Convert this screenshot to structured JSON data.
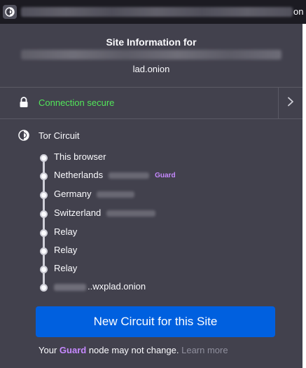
{
  "urlbar": {
    "icon": "tor-onion-icon",
    "url_visible_suffix": "on"
  },
  "panel": {
    "title": "Site Information for",
    "host_suffix": "lad.onion"
  },
  "connection": {
    "status": "Connection secure",
    "status_color": "#53e65a",
    "lock_icon": "lock-icon",
    "chevron_icon": "chevron-right-icon"
  },
  "circuit": {
    "title": "Tor Circuit",
    "icon": "tor-onion-icon",
    "nodes": [
      {
        "label": "This browser"
      },
      {
        "label": "Netherlands",
        "badge": "Guard"
      },
      {
        "label": "Germany"
      },
      {
        "label": "Switzerland"
      },
      {
        "label": "Relay"
      },
      {
        "label": "Relay"
      },
      {
        "label": "Relay"
      },
      {
        "label": "..wxplad.onion"
      }
    ]
  },
  "actions": {
    "new_circuit": "New Circuit for this Site"
  },
  "footer": {
    "prefix": "Your",
    "guard": "Guard",
    "suffix": "node may not change.",
    "learn_more": "Learn more"
  },
  "colors": {
    "panel_bg": "#42414d",
    "accent_button": "#0060df",
    "guard_purple": "#c689ff"
  }
}
